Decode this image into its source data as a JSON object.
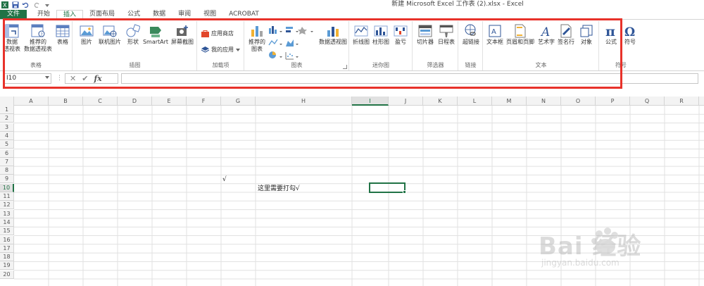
{
  "window": {
    "title": "新建 Microsoft Excel 工作表 (2).xlsx - Excel"
  },
  "tabs": [
    {
      "label": "文件"
    },
    {
      "label": "开始"
    },
    {
      "label": "插入"
    },
    {
      "label": "页面布局"
    },
    {
      "label": "公式"
    },
    {
      "label": "数据"
    },
    {
      "label": "审阅"
    },
    {
      "label": "视图"
    },
    {
      "label": "ACROBAT"
    }
  ],
  "ribbon": {
    "groups": {
      "tables": {
        "label": "表格",
        "pivot_table": "数据\n透视表",
        "recommended_pivot": "推荐的\n数据透视表",
        "table": "表格"
      },
      "illustrations": {
        "label": "插图",
        "pictures": "图片",
        "online_pictures": "联机图片",
        "shapes": "形状",
        "smartart": "SmartArt",
        "screenshot": "屏幕截图"
      },
      "addins": {
        "label": "加载项",
        "store": "应用商店",
        "my_apps": "我的应用"
      },
      "charts": {
        "label": "图表",
        "recommended_charts": "推荐的\n图表",
        "pivot_chart": "数据透视图"
      },
      "sparklines": {
        "label": "迷你图",
        "line": "折线图",
        "column": "柱形图",
        "win_loss": "盈亏"
      },
      "filters": {
        "label": "筛选器",
        "slicer": "切片器",
        "timeline": "日程表"
      },
      "links": {
        "label": "链接",
        "hyperlink": "超链接"
      },
      "text": {
        "label": "文本",
        "textbox": "文本框",
        "header_footer": "页眉和页脚",
        "wordart": "艺术字",
        "signature": "签名行",
        "object": "对象"
      },
      "symbols": {
        "label": "符号",
        "equation": "公式",
        "symbol": "符号"
      }
    }
  },
  "formula_bar": {
    "name_box": "I10",
    "fx": "fx",
    "value": ""
  },
  "sheet": {
    "columns": [
      "A",
      "B",
      "C",
      "D",
      "E",
      "F",
      "G",
      "H",
      "I",
      "J",
      "K",
      "L",
      "M",
      "N",
      "O",
      "P",
      "Q",
      "R"
    ],
    "rows": [
      "1",
      "2",
      "3",
      "4",
      "5",
      "6",
      "7",
      "8",
      "9",
      "10",
      "11",
      "12",
      "13",
      "14",
      "15",
      "16",
      "17",
      "18",
      "19",
      "20"
    ],
    "selected_cell": "I10",
    "cells": {
      "G9": "√",
      "H10": "这里需要打勾√"
    }
  },
  "watermark": {
    "brand": "Bai 经验",
    "url": "jingyan.baidu.com"
  },
  "colors": {
    "excel_green": "#217346",
    "annotation_red": "#e8322a"
  }
}
